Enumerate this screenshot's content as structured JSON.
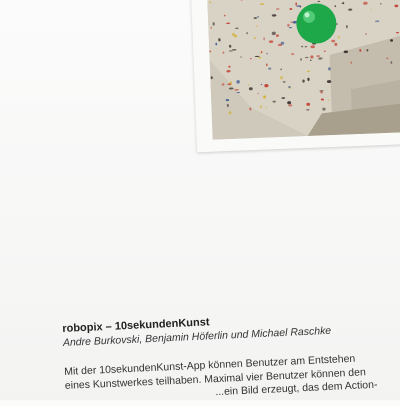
{
  "document": {
    "title": "robopix – 10sekundenKunst",
    "authors": "Andre Burkovski, Benjamin Höferlin und Michael Raschke",
    "description_lines": [
      "Mit der 10sekundenKunst-App können Benutzer am Entstehen",
      "eines Kunstwerkes teilhaben. Maximal vier Benutzer können den",
      "...ein Bild erzeugt, das dem Action-"
    ]
  },
  "photo": {
    "subject": "paint-splatter-canvas-with-green-ball",
    "colors": {
      "ball": "#1fa84a",
      "canvas": "#d8d2c4",
      "wall": "#c7c1b3",
      "splatter_red": "#c0392b",
      "splatter_blue": "#2c4a8a",
      "splatter_dark": "#3a2c2a",
      "splatter_yellow": "#d4b23a"
    }
  }
}
